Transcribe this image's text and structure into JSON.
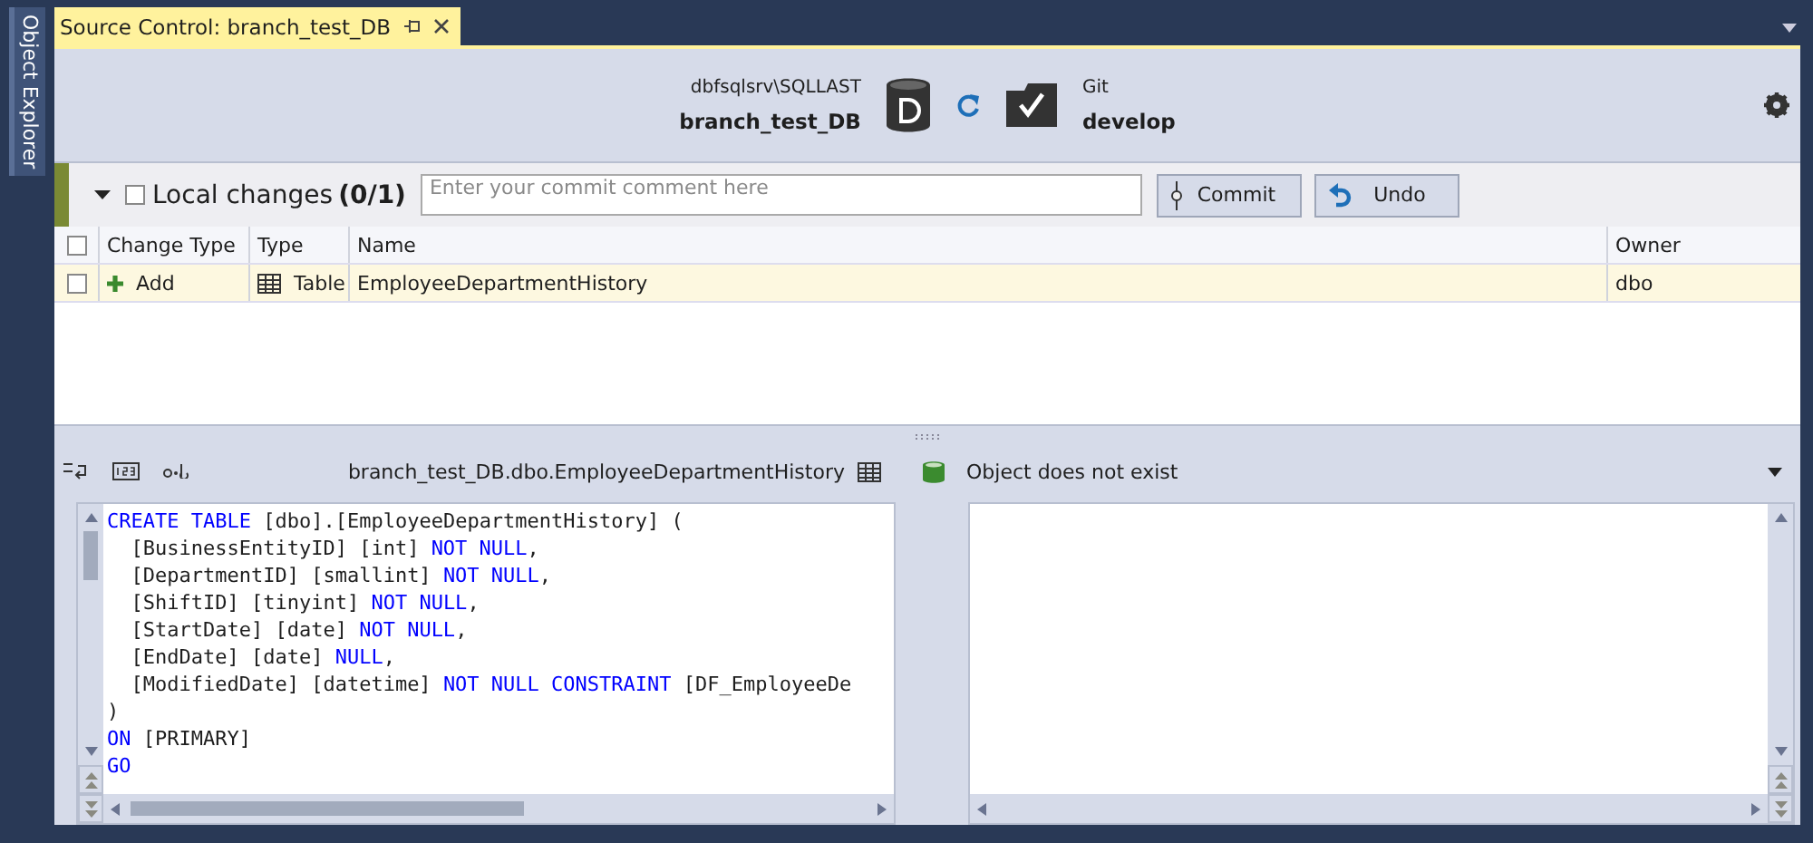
{
  "sidebar": {
    "label": "Object Explorer"
  },
  "tab": {
    "title": "Source Control: branch_test_DB",
    "selected": true
  },
  "header": {
    "server": "dbfsqlsrv\\SQLLAST",
    "database": "branch_test_DB",
    "vcs": "Git",
    "branch": "develop"
  },
  "toolbar": {
    "section_label": "Local changes",
    "count": "(0/1)",
    "select_all_checked": false,
    "commit_comment": {
      "placeholder": "Enter your commit comment here"
    },
    "buttons": [
      "Commit",
      "Undo"
    ]
  },
  "table": {
    "header_checked": false,
    "columns": [
      "Change Type",
      "Type",
      "Name",
      "Owner"
    ],
    "rows": [
      {
        "checked": false,
        "selected": true,
        "change_type": "Add",
        "type": "Table",
        "name": "EmployeeDepartmentHistory",
        "owner": "dbo"
      }
    ]
  },
  "diff": {
    "left_title": "branch_test_DB.dbo.EmployeeDepartmentHistory",
    "right_title": "Object does not exist",
    "left_code": [
      {
        "tokens": [
          {
            "kind": "keyword",
            "text": "CREATE TABLE"
          },
          {
            "kind": "plain",
            "text": " [dbo].[EmployeeDepartmentHistory] ("
          }
        ]
      },
      {
        "tokens": [
          {
            "kind": "plain",
            "text": "  [BusinessEntityID] [int] "
          },
          {
            "kind": "keyword",
            "text": "NOT NULL"
          },
          {
            "kind": "plain",
            "text": ","
          }
        ]
      },
      {
        "tokens": [
          {
            "kind": "plain",
            "text": "  [DepartmentID] [smallint] "
          },
          {
            "kind": "keyword",
            "text": "NOT NULL"
          },
          {
            "kind": "plain",
            "text": ","
          }
        ]
      },
      {
        "tokens": [
          {
            "kind": "plain",
            "text": "  [ShiftID] [tinyint] "
          },
          {
            "kind": "keyword",
            "text": "NOT NULL"
          },
          {
            "kind": "plain",
            "text": ","
          }
        ]
      },
      {
        "tokens": [
          {
            "kind": "plain",
            "text": "  [StartDate] [date] "
          },
          {
            "kind": "keyword",
            "text": "NOT NULL"
          },
          {
            "kind": "plain",
            "text": ","
          }
        ]
      },
      {
        "tokens": [
          {
            "kind": "plain",
            "text": "  [EndDate] [date] "
          },
          {
            "kind": "keyword",
            "text": "NULL"
          },
          {
            "kind": "plain",
            "text": ","
          }
        ]
      },
      {
        "tokens": [
          {
            "kind": "plain",
            "text": "  [ModifiedDate] [datetime] "
          },
          {
            "kind": "keyword",
            "text": "NOT NULL CONSTRAINT"
          },
          {
            "kind": "plain",
            "text": " [DF_EmployeeDe"
          }
        ]
      },
      {
        "tokens": [
          {
            "kind": "plain",
            "text": ")"
          }
        ]
      },
      {
        "tokens": [
          {
            "kind": "keyword",
            "text": "ON"
          },
          {
            "kind": "plain",
            "text": " [PRIMARY]"
          }
        ]
      },
      {
        "tokens": [
          {
            "kind": "keyword",
            "text": "GO"
          }
        ]
      }
    ]
  }
}
